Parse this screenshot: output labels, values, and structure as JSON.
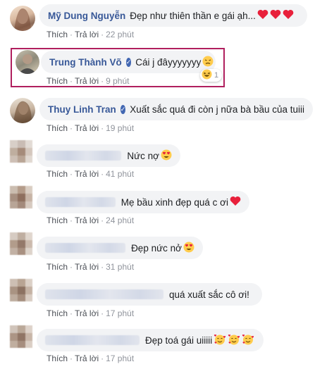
{
  "comments": [
    {
      "author": "Mỹ Dung Nguyễn",
      "text": "Đẹp như thiên thần e gái ạh...",
      "like": "Thích",
      "reply": "Trả lời",
      "time": "22 phút",
      "emojis": [
        "heart-icon",
        "heart-icon",
        "heart-icon"
      ]
    },
    {
      "author": "Trung Thành Võ",
      "verified": "✓",
      "text": "Cái j đâyyyyyyy",
      "like": "Thích",
      "reply": "Trả lời",
      "time": "9 phút",
      "reaction_count": "1",
      "highlighted": true
    },
    {
      "author": "Thuy Linh Tran",
      "verified": "✓",
      "text": "Xuất sắc quá đi còn j nữa bà bầu của tuiii",
      "like": "Thích",
      "reply": "Trả lời",
      "time": "19 phút"
    },
    {
      "author": "",
      "text": "Nức nợ",
      "like": "Thích",
      "reply": "Trả lời",
      "time": "41 phút",
      "emojis": [
        "heart-eyes-icon"
      ]
    },
    {
      "author": "",
      "text": "Mẹ bầu xinh đẹp quá c ơi",
      "like": "Thích",
      "reply": "Trả lời",
      "time": "24 phút",
      "emojis": [
        "heart-icon"
      ]
    },
    {
      "author": "",
      "text": "Đẹp nức nở",
      "like": "Thích",
      "reply": "Trả lời",
      "time": "31 phút",
      "emojis": [
        "heart-eyes-icon"
      ]
    },
    {
      "author": "",
      "text": "quá xuất sắc cô ơi!",
      "like": "Thích",
      "reply": "Trả lời",
      "time": "17 phút"
    },
    {
      "author": "",
      "text": "Đẹp toá gái uiiiii",
      "like": "Thích",
      "reply": "Trả lời",
      "time": "17 phút",
      "emojis": [
        "smiling-hearts-icon",
        "smiling-hearts-icon",
        "smiling-hearts-icon"
      ]
    }
  ],
  "colors": {
    "author": "#385898",
    "bubble": "#f2f3f5",
    "highlight": "#b01f5e",
    "heart": "#e8203b"
  }
}
